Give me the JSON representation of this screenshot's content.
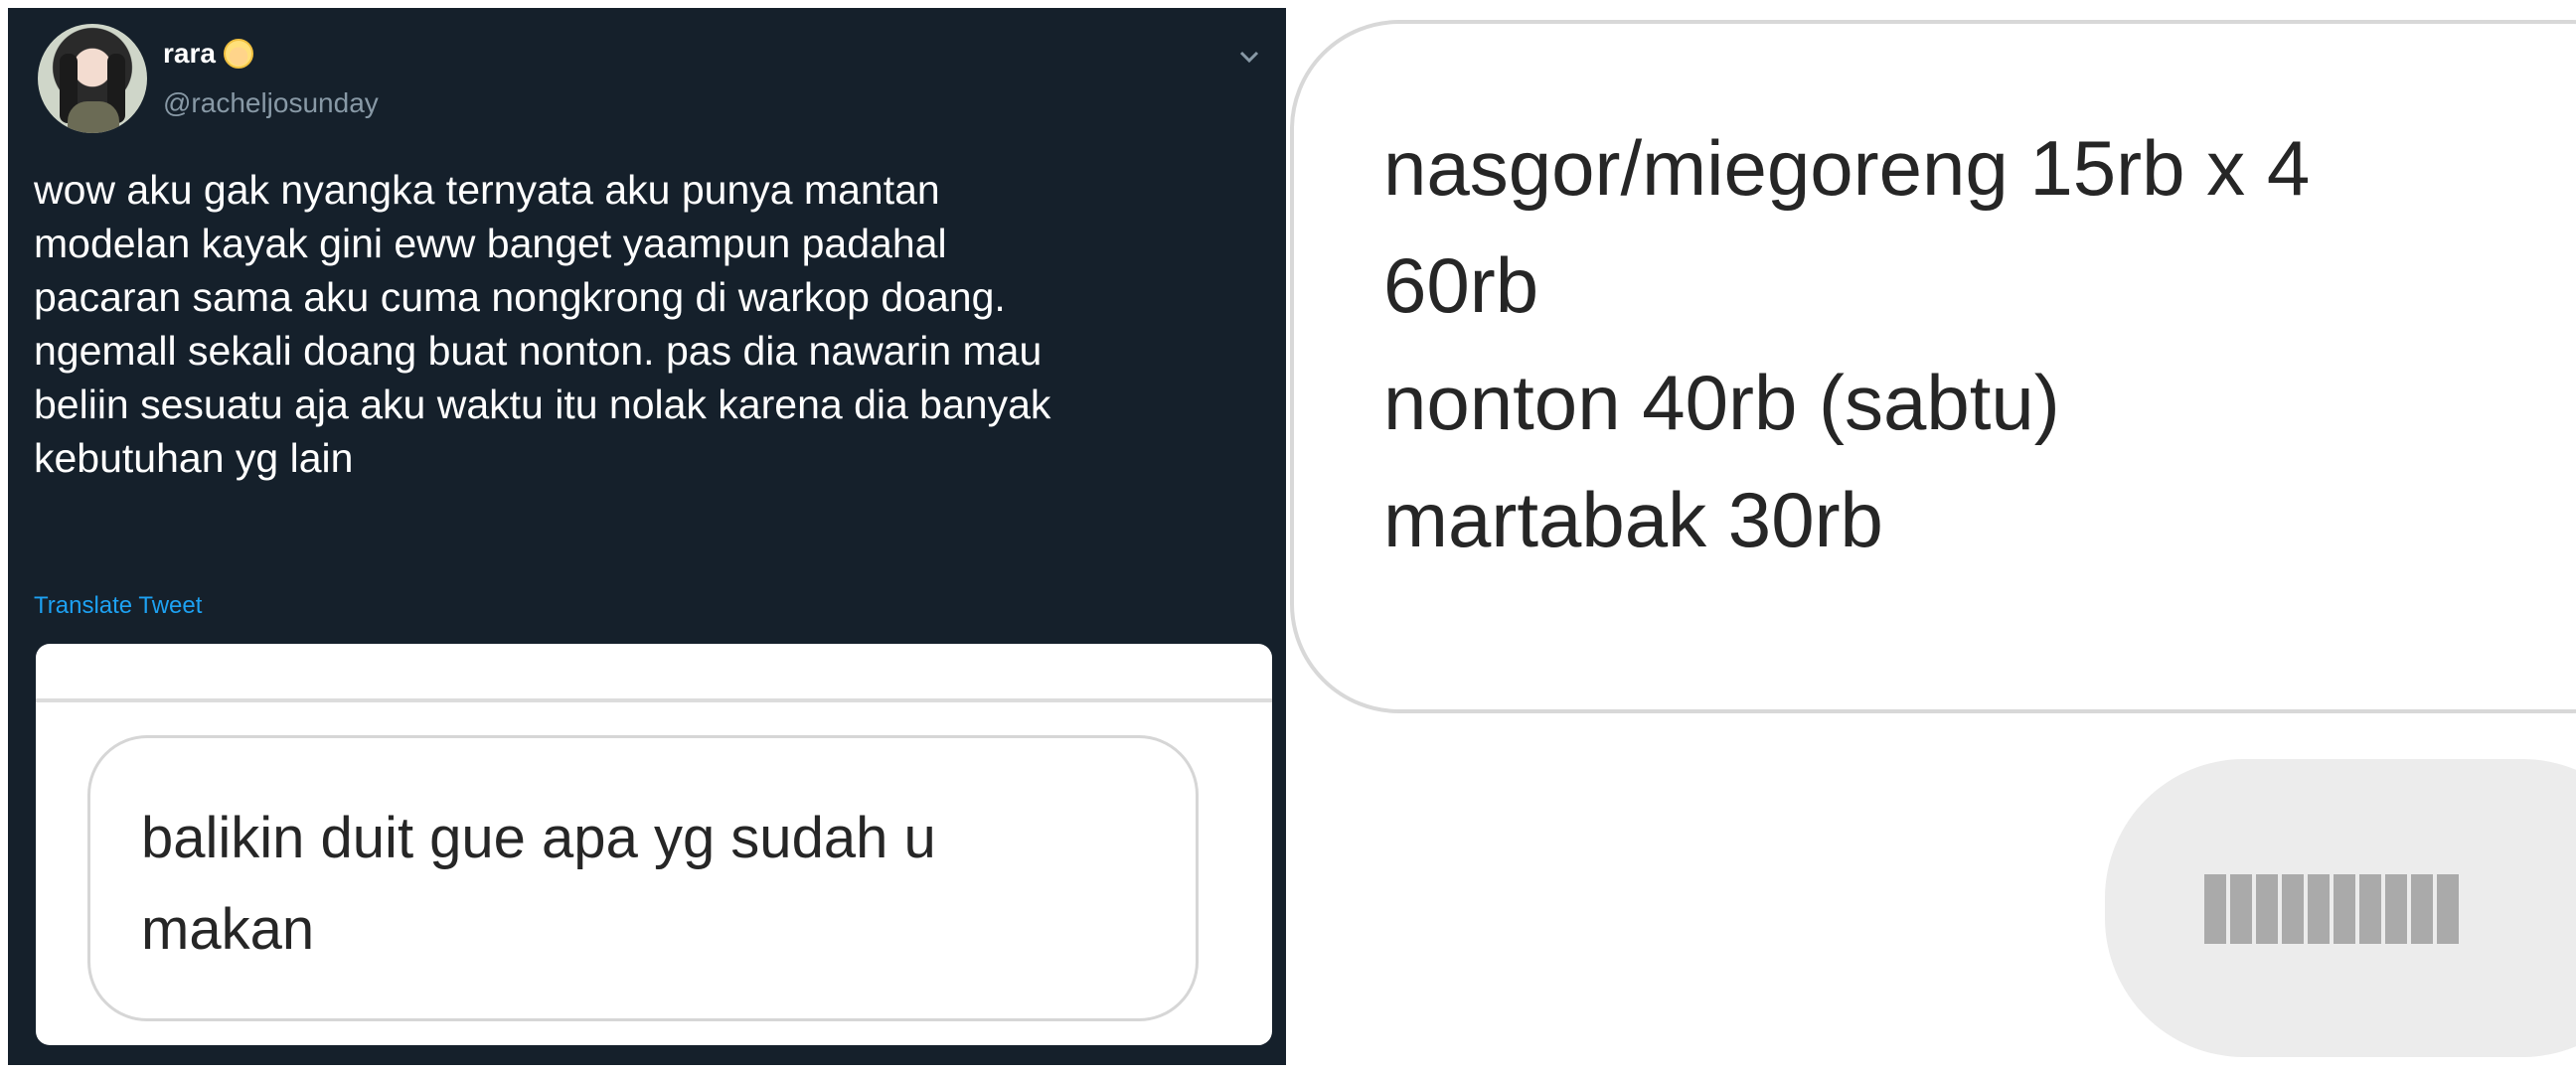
{
  "tweet": {
    "display_name": "rara",
    "handle": "@racheljosunday",
    "text": "wow aku gak nyangka ternyata aku punya mantan\nmodelan kayak gini eww banget yaampun padahal\npacaran sama aku cuma nongkrong di warkop doang.\nngemall sekali doang buat nonton. pas dia nawarin mau\nbeliin sesuatu aja aku waktu itu nolak karena dia banyak\nkebutuhan yg lain",
    "translate_label": "Translate Tweet",
    "embed_text": "balikin duit gue apa yg sudah u\nmakan"
  },
  "receipt": {
    "lines": [
      "nasgor/miegoreng 15rb x 4",
      "60rb",
      "nonton 40rb (sabtu)",
      "martabak 30rb"
    ]
  },
  "colors": {
    "tweet_bg": "#15202b",
    "link": "#1da1f2",
    "muted": "#8899a6"
  },
  "icons": {
    "emoji": "blonde-person-emoji-icon",
    "menu": "chevron-down-icon"
  }
}
